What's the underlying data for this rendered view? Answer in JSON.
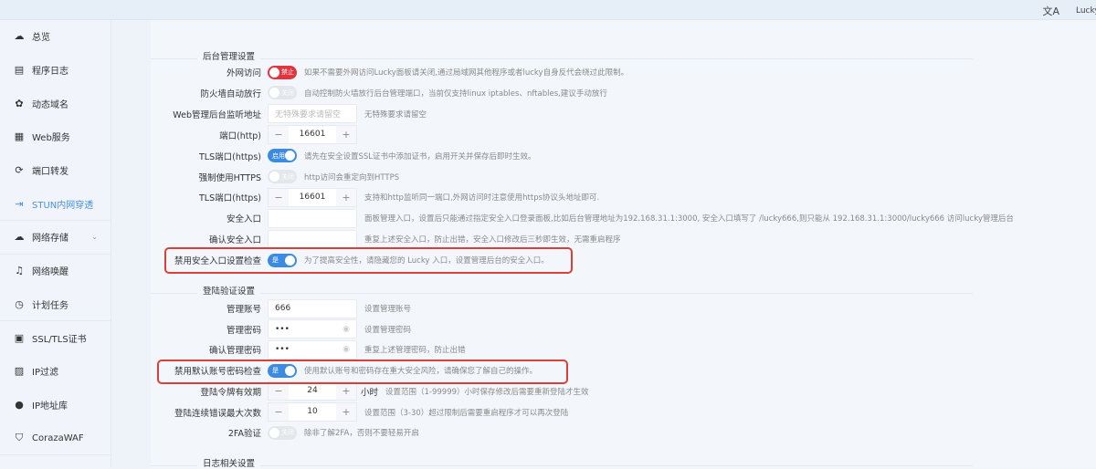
{
  "topbar": {
    "translate_icon": "translate-icon",
    "user": "Lucky"
  },
  "sidebar": {
    "items": [
      {
        "label": "总览",
        "icon": "dashboard-icon",
        "glyph": "☁"
      },
      {
        "label": "程序日志",
        "icon": "log-icon",
        "glyph": "▤"
      },
      {
        "label": "动态域名",
        "icon": "ddns-icon",
        "glyph": "✿"
      },
      {
        "label": "Web服务",
        "icon": "web-service-icon",
        "glyph": "▦"
      },
      {
        "label": "端口转发",
        "icon": "port-forward-icon",
        "glyph": "⟳"
      },
      {
        "label": "STUN内网穿透",
        "icon": "stun-icon",
        "glyph": "⇥",
        "active": true,
        "sep": true
      },
      {
        "label": "网络存储",
        "icon": "cloud-storage-icon",
        "glyph": "☁",
        "chev": true,
        "sep": true
      },
      {
        "label": "网络唤醒",
        "icon": "bell-icon",
        "glyph": "♫"
      },
      {
        "label": "计划任务",
        "icon": "clock-icon",
        "glyph": "◷",
        "sep": true
      },
      {
        "label": "SSL/TLS证书",
        "icon": "certificate-icon",
        "glyph": "▣"
      },
      {
        "label": "IP过滤",
        "icon": "filter-icon",
        "glyph": "▨"
      },
      {
        "label": "IP地址库",
        "icon": "user-icon",
        "glyph": "●"
      },
      {
        "label": "CorazaWAF",
        "icon": "shield-icon",
        "glyph": "⛉",
        "sep": true
      }
    ]
  },
  "sections": [
    {
      "title": "后台管理设置",
      "rows": [
        {
          "label": "外网访问",
          "type": "toggle",
          "state": "red",
          "text": "禁止",
          "hint": "如果不需要外网访问Lucky面板请关闭,通过局域网其他程序或者lucky自身反代会绕过此限制。"
        },
        {
          "label": "防火墙自动放行",
          "type": "toggle",
          "state": "off",
          "text": "关闭",
          "hint": "自动控制防火墙放行后台管理端口，当前仅支持linux iptables、nftables,建议手动放行"
        },
        {
          "label": "Web管理后台监听地址",
          "type": "input",
          "placeholder": "无特殊要求请留空",
          "hint": "无特殊要求请留空"
        },
        {
          "label": "端口(http)",
          "type": "stepper",
          "value": "16601",
          "hint": ""
        },
        {
          "label": "TLS端口(https)",
          "type": "toggle",
          "state": "on",
          "text": "启用",
          "hint": "请先在安全设置SSL证书中添加证书，启用开关并保存后即时生效。"
        },
        {
          "label": "强制使用HTTPS",
          "type": "toggle",
          "state": "off",
          "text": "关闭",
          "hint": "http访问会重定向到HTTPS"
        },
        {
          "label": "TLS端口(https)",
          "type": "stepper",
          "value": "16601",
          "hint": "支持和http监听同一端口,外网访问时注意使用https协议头地址即可."
        },
        {
          "label": "安全入口",
          "type": "input",
          "value": "",
          "hint": "面板管理入口，设置后只能通过指定安全入口登录面板,比如后台管理地址为192.168.31.1:3000, 安全入口填写了 /lucky666,则只能从 192.168.31.1:3000/lucky666 访问lucky管理后台"
        },
        {
          "label": "确认安全入口",
          "type": "input",
          "value": "",
          "hint": "重复上述安全入口，防止出错，安全入口修改后三秒即生效，无需重启程序"
        },
        {
          "label": "禁用安全入口设置检查",
          "type": "toggle",
          "state": "on",
          "text": "是",
          "hint": "为了提高安全性，请隐藏您的 Lucky 入口，设置管理后台的安全入口。"
        }
      ]
    },
    {
      "title": "登陆验证设置",
      "rows": [
        {
          "label": "管理账号",
          "type": "input",
          "value": "666",
          "hint": "设置管理账号"
        },
        {
          "label": "管理密码",
          "type": "password",
          "value": "•••",
          "hint": "设置管理密码"
        },
        {
          "label": "确认管理密码",
          "type": "password",
          "value": "•••",
          "hint": "重复上述管理密码，防止出错"
        },
        {
          "label": "禁用默认账号密码检查",
          "type": "toggle",
          "state": "on",
          "text": "是",
          "hint": "使用默认账号和密码存在重大安全风险，请确保您了解自己的操作。"
        },
        {
          "label": "登陆令牌有效期",
          "type": "stepper",
          "value": "24",
          "unit": "小时",
          "hint": "设置范围（1-99999）小时保存修改后需要重新登陆才生效"
        },
        {
          "label": "登陆连续错误最大次数",
          "type": "stepper",
          "value": "10",
          "hint": "设置范围（3-30）超过限制后需要重启程序才可以再次登陆"
        },
        {
          "label": "2FA验证",
          "type": "toggle",
          "state": "off",
          "text": "关闭",
          "hint": "除非了解2FA，否则不要轻易开启"
        }
      ]
    },
    {
      "title": "日志相关设置",
      "rows": []
    }
  ]
}
